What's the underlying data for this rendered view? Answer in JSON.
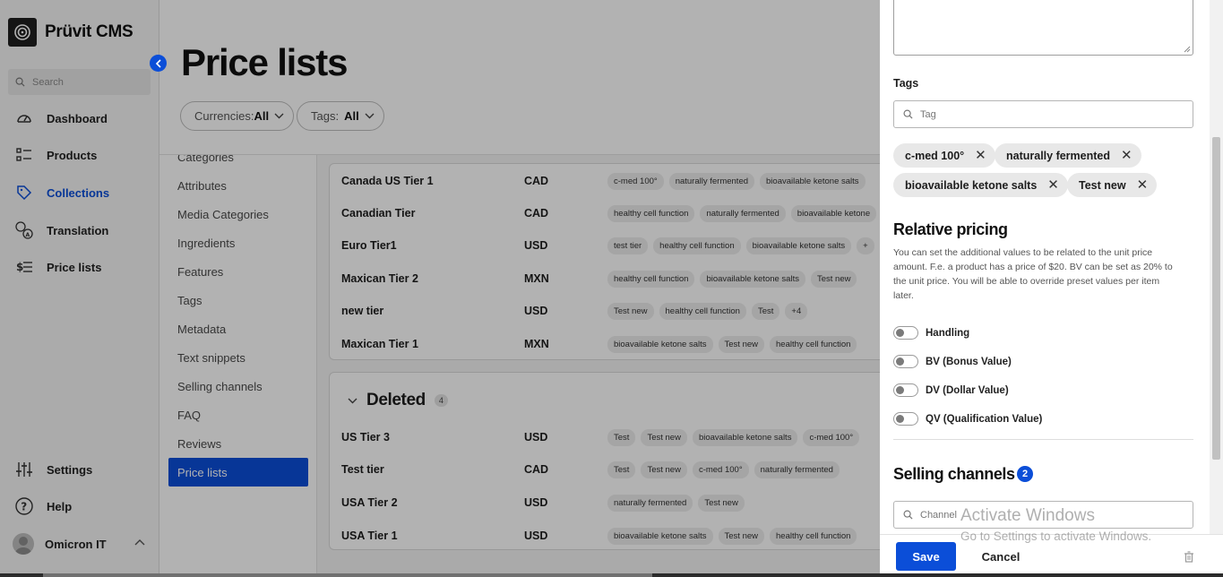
{
  "app": {
    "title": "Prüvit CMS"
  },
  "search": {
    "placeholder": "Search"
  },
  "nav": {
    "dashboard": "Dashboard",
    "products": "Products",
    "collections": "Collections",
    "translation": "Translation",
    "price_lists": "Price lists",
    "settings": "Settings",
    "help": "Help",
    "user": "Omicron IT"
  },
  "page": {
    "title": "Price lists",
    "filter_currencies_label": "Currencies:",
    "filter_currencies_value": "All",
    "filter_tags_label": "Tags:",
    "filter_tags_value": "All"
  },
  "subnav": [
    "Categories",
    "Attributes",
    "Media Categories",
    "Ingredients",
    "Features",
    "Tags",
    "Metadata",
    "Text snippets",
    "Selling channels",
    "FAQ",
    "Reviews",
    "Price lists"
  ],
  "active_rows": [
    {
      "name": "Canada US Tier 1",
      "currency": "CAD",
      "tags": [
        "c-med 100°",
        "naturally fermented",
        "bioavailable ketone salts"
      ]
    },
    {
      "name": "Canadian Tier",
      "currency": "CAD",
      "tags": [
        "healthy cell function",
        "naturally fermented",
        "bioavailable ketone"
      ]
    },
    {
      "name": "Euro Tier1",
      "currency": "USD",
      "tags": [
        "test tier",
        "healthy cell function",
        "bioavailable ketone salts",
        "+"
      ]
    },
    {
      "name": "Maxican Tier 2",
      "currency": "MXN",
      "tags": [
        "healthy cell function",
        "bioavailable ketone salts",
        "Test new"
      ]
    },
    {
      "name": "new tier",
      "currency": "USD",
      "tags": [
        "Test new",
        "healthy cell function",
        "Test",
        "+4"
      ]
    },
    {
      "name": "Maxican Tier 1",
      "currency": "MXN",
      "tags": [
        "bioavailable ketone salts",
        "Test new",
        "healthy cell function"
      ]
    }
  ],
  "deleted": {
    "title": "Deleted",
    "count": "4",
    "rows": [
      {
        "name": "US Tier 3",
        "currency": "USD",
        "tags": [
          "Test",
          "Test new",
          "bioavailable ketone salts",
          "c-med 100°"
        ]
      },
      {
        "name": "Test tier",
        "currency": "CAD",
        "tags": [
          "Test",
          "Test new",
          "c-med 100°",
          "naturally fermented"
        ]
      },
      {
        "name": "USA Tier 2",
        "currency": "USD",
        "tags": [
          "naturally fermented",
          "Test new"
        ]
      },
      {
        "name": "USA Tier 1",
        "currency": "USD",
        "tags": [
          "bioavailable ketone salts",
          "Test new",
          "healthy cell function"
        ]
      }
    ]
  },
  "drawer": {
    "tags_label": "Tags",
    "tag_placeholder": "Tag",
    "chips": [
      "c-med 100°",
      "naturally fermented",
      "bioavailable ketone salts",
      "Test new"
    ],
    "relative_pricing_title": "Relative pricing",
    "relative_pricing_desc": "You can set the additional values to be related to the unit price amount. F.e. a product has a price of $20. BV can be set as 20% to the unit price. You will be able to override preset values per item later.",
    "toggles": [
      "Handling",
      "BV (Bonus Value)",
      "DV (Dollar Value)",
      "QV (Qualification Value)"
    ],
    "selling_channels_title": "Selling channels",
    "selling_channels_count": "2",
    "channel_placeholder": "Channel",
    "save_label": "Save",
    "cancel_label": "Cancel"
  },
  "watermark": {
    "line1": "Activate Windows",
    "line2": "Go to Settings to activate Windows."
  },
  "colors": {
    "accent": "#0b4ed8",
    "overlay": "rgba(0,0,0,0.30)"
  }
}
